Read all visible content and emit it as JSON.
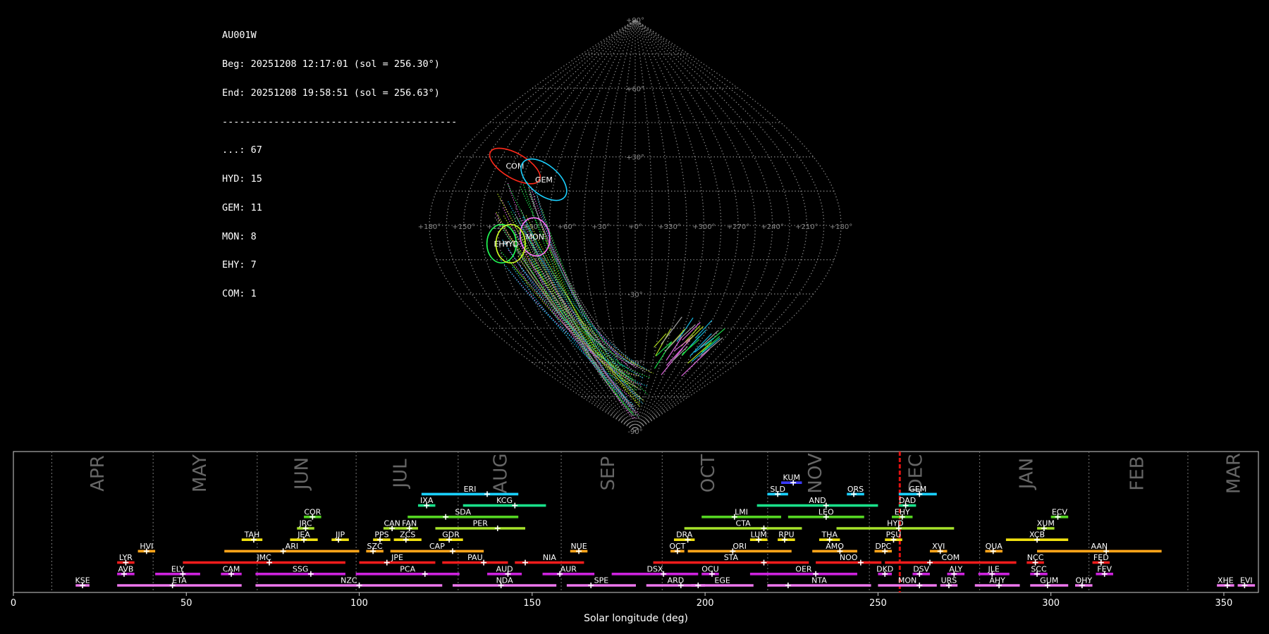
{
  "stats": {
    "station": "AU001W",
    "beg": "Beg: 20251208 12:17:01 (sol = 256.30°)",
    "end": "End: 20251208 19:58:51 (sol = 256.63°)",
    "sep": "-----------------------------------------",
    "counts": [
      "...: 67",
      "HYD: 15",
      "GEM: 11",
      "MON: 8",
      "EHY: 7",
      "COM: 1"
    ]
  },
  "sky_map": {
    "lat_labels": [
      {
        "text": "+90°",
        "lat": 90
      },
      {
        "text": "+60°",
        "lat": 60
      },
      {
        "text": "+30°",
        "lat": 30
      },
      {
        "text": "-30°",
        "lat": -30
      },
      {
        "text": "-60°",
        "lat": -60
      },
      {
        "text": "-90°",
        "lat": -90
      }
    ],
    "lon_labels": [
      {
        "text": "+180°",
        "lon": -180
      },
      {
        "text": "+150°",
        "lon": -150
      },
      {
        "text": "+120°",
        "lon": -120
      },
      {
        "text": "+90°",
        "lon": -90
      },
      {
        "text": "+60°",
        "lon": -60
      },
      {
        "text": "+30°",
        "lon": -30
      },
      {
        "text": "+0°",
        "lon": 0
      },
      {
        "text": "+330°",
        "lon": 30
      },
      {
        "text": "+300°",
        "lon": 60
      },
      {
        "text": "+270°",
        "lon": 90
      },
      {
        "text": "+240°",
        "lon": 120
      },
      {
        "text": "+210°",
        "lon": 150
      },
      {
        "text": "+180°",
        "lon": 180
      }
    ],
    "radiants": [
      {
        "name": "COM",
        "lon": -117,
        "lat": 26,
        "rx": 5.5,
        "ry": 12.5,
        "rot": -60,
        "color": "#ff2a1a"
      },
      {
        "name": "GEM",
        "lon": -85,
        "lat": 20,
        "rx": 6.5,
        "ry": 12,
        "rot": -50,
        "color": "#1ad0ff"
      },
      {
        "name": "MON",
        "lon": -88,
        "lat": -5,
        "rx": 6.5,
        "ry": 8.5,
        "rot": -10,
        "color": "#ff77ff"
      },
      {
        "name": "EHY",
        "lon": -118,
        "lat": -8,
        "rx": 6.5,
        "ry": 8.5,
        "rot": 0,
        "color": "#22ff55"
      },
      {
        "name": "HYD",
        "lon": -110,
        "lat": -8,
        "rx": 6.5,
        "ry": 8.5,
        "rot": 0,
        "color": "#ccff22"
      }
    ]
  },
  "chart_data": {
    "type": "timeline",
    "xlabel": "Solar longitude (deg)",
    "xlim": [
      0,
      360
    ],
    "xticks": [
      0,
      50,
      100,
      150,
      200,
      250,
      300,
      350
    ],
    "current_sol": 256.3,
    "months": [
      {
        "name": "APR",
        "start": 11.1,
        "label_at": 24.5
      },
      {
        "name": "MAY",
        "start": 40.4,
        "label_at": 54
      },
      {
        "name": "JUN",
        "start": 70.5,
        "label_at": 83.5
      },
      {
        "name": "JUL",
        "start": 99.1,
        "label_at": 112
      },
      {
        "name": "AUG",
        "start": 128.6,
        "label_at": 141
      },
      {
        "name": "SEP",
        "start": 158.4,
        "label_at": 172
      },
      {
        "name": "OCT",
        "start": 187.6,
        "label_at": 201
      },
      {
        "name": "NOV",
        "start": 218.1,
        "label_at": 232
      },
      {
        "name": "DEC",
        "start": 247.5,
        "label_at": 261
      },
      {
        "name": "JAN",
        "start": 279.4,
        "label_at": 293
      },
      {
        "name": "FEB",
        "start": 311.0,
        "label_at": 325
      },
      {
        "name": "MAR",
        "start": 339.6,
        "label_at": 353
      }
    ],
    "showers": [
      {
        "code": "KUM",
        "start": 222,
        "end": 228,
        "peak": 225.5,
        "row": 9,
        "color": "#3a3aff"
      },
      {
        "code": "ERI",
        "start": 118,
        "end": 146,
        "peak": 137,
        "row": 8,
        "color": "#1ad0ff"
      },
      {
        "code": "SLD",
        "start": 218,
        "end": 224,
        "peak": 221,
        "row": 8,
        "color": "#1ad0ff"
      },
      {
        "code": "ORS",
        "start": 241,
        "end": 246,
        "peak": 243,
        "row": 8,
        "color": "#1ad0ff"
      },
      {
        "code": "GEM",
        "start": 256,
        "end": 267,
        "peak": 262,
        "row": 8,
        "color": "#1ad0ff"
      },
      {
        "code": "IXA",
        "start": 117,
        "end": 122,
        "peak": 119.5,
        "row": 7,
        "color": "#19e08a"
      },
      {
        "code": "KCG",
        "start": 130,
        "end": 154,
        "peak": 145,
        "row": 7,
        "color": "#19e08a"
      },
      {
        "code": "AND",
        "start": 215,
        "end": 250,
        "peak": 235,
        "row": 7,
        "color": "#19e08a"
      },
      {
        "code": "DAD",
        "start": 256,
        "end": 261,
        "peak": 258,
        "row": 7,
        "color": "#19e08a"
      },
      {
        "code": "COR",
        "start": 84,
        "end": 89,
        "peak": 86.5,
        "row": 6,
        "color": "#55d422"
      },
      {
        "code": "SDA",
        "start": 114,
        "end": 146,
        "peak": 125,
        "row": 6,
        "color": "#55d422"
      },
      {
        "code": "LMI",
        "start": 199,
        "end": 222,
        "peak": 208.5,
        "row": 6,
        "color": "#55d422"
      },
      {
        "code": "LEO",
        "start": 224,
        "end": 246,
        "peak": 235,
        "row": 6,
        "color": "#55d422"
      },
      {
        "code": "EHY",
        "start": 254,
        "end": 260,
        "peak": 257,
        "row": 6,
        "color": "#55d422"
      },
      {
        "code": "ECV",
        "start": 300,
        "end": 305,
        "peak": 302,
        "row": 6,
        "color": "#55d422"
      },
      {
        "code": "JRC",
        "start": 82,
        "end": 87,
        "peak": 84.5,
        "row": 5,
        "color": "#a6e22a"
      },
      {
        "code": "CAN",
        "start": 107,
        "end": 112,
        "peak": 109.5,
        "row": 5,
        "color": "#a6e22a"
      },
      {
        "code": "FAN",
        "start": 112,
        "end": 117,
        "peak": 114.5,
        "row": 5,
        "color": "#a6e22a"
      },
      {
        "code": "PER",
        "start": 122,
        "end": 148,
        "peak": 140,
        "row": 5,
        "color": "#a6e22a"
      },
      {
        "code": "CTA",
        "start": 194,
        "end": 228,
        "peak": 217,
        "row": 5,
        "color": "#a6e22a"
      },
      {
        "code": "HYD",
        "start": 238,
        "end": 272,
        "peak": 256,
        "row": 5,
        "color": "#a6e22a"
      },
      {
        "code": "XUM",
        "start": 296,
        "end": 301,
        "peak": 298,
        "row": 5,
        "color": "#a6e22a"
      },
      {
        "code": "TAH",
        "start": 66,
        "end": 72,
        "peak": 69.5,
        "row": 4,
        "color": "#f0e010"
      },
      {
        "code": "JEA",
        "start": 80,
        "end": 88,
        "peak": 84,
        "row": 4,
        "color": "#f0e010"
      },
      {
        "code": "JIP",
        "start": 92,
        "end": 97,
        "peak": 94,
        "row": 4,
        "color": "#f0e010"
      },
      {
        "code": "PPS",
        "start": 104,
        "end": 109,
        "peak": 106,
        "row": 4,
        "color": "#f0e010"
      },
      {
        "code": "ZCS",
        "start": 110,
        "end": 118,
        "peak": 113.5,
        "row": 4,
        "color": "#f0e010"
      },
      {
        "code": "GDR",
        "start": 123,
        "end": 130,
        "peak": 126,
        "row": 4,
        "color": "#f0e010"
      },
      {
        "code": "DRA",
        "start": 191,
        "end": 197,
        "peak": 195,
        "row": 4,
        "color": "#f0e010"
      },
      {
        "code": "LUM",
        "start": 213,
        "end": 218,
        "peak": 215.5,
        "row": 4,
        "color": "#f0e010"
      },
      {
        "code": "RPU",
        "start": 221,
        "end": 226,
        "peak": 223,
        "row": 4,
        "color": "#f0e010"
      },
      {
        "code": "THA",
        "start": 233,
        "end": 239,
        "peak": 236,
        "row": 4,
        "color": "#f0e010"
      },
      {
        "code": "PSU",
        "start": 252,
        "end": 257,
        "peak": 254.5,
        "row": 4,
        "color": "#f0e010"
      },
      {
        "code": "XCB",
        "start": 287,
        "end": 305,
        "peak": 296,
        "row": 4,
        "color": "#f0e010"
      },
      {
        "code": "HVI",
        "start": 36,
        "end": 41,
        "peak": 38.5,
        "row": 3,
        "color": "#ffa51a"
      },
      {
        "code": "ARI",
        "start": 61,
        "end": 100,
        "peak": 78,
        "row": 3,
        "color": "#ffa51a"
      },
      {
        "code": "SZC",
        "start": 102,
        "end": 107,
        "peak": 104,
        "row": 3,
        "color": "#ffa51a"
      },
      {
        "code": "CAP",
        "start": 109,
        "end": 136,
        "peak": 127,
        "row": 3,
        "color": "#ffa51a"
      },
      {
        "code": "NUE",
        "start": 161,
        "end": 166,
        "peak": 163.5,
        "row": 3,
        "color": "#ffa51a"
      },
      {
        "code": "OCT",
        "start": 190,
        "end": 194,
        "peak": 192,
        "row": 3,
        "color": "#ffa51a"
      },
      {
        "code": "ORI",
        "start": 195,
        "end": 225,
        "peak": 208,
        "row": 3,
        "color": "#ffa51a"
      },
      {
        "code": "AMO",
        "start": 231,
        "end": 244,
        "peak": 239,
        "row": 3,
        "color": "#ffa51a"
      },
      {
        "code": "DPC",
        "start": 249,
        "end": 254,
        "peak": 252,
        "row": 3,
        "color": "#ffa51a"
      },
      {
        "code": "XVI",
        "start": 265,
        "end": 270,
        "peak": 268,
        "row": 3,
        "color": "#ffa51a"
      },
      {
        "code": "QUA",
        "start": 281,
        "end": 286,
        "peak": 283.3,
        "row": 3,
        "color": "#ffa51a"
      },
      {
        "code": "AAN",
        "start": 296,
        "end": 332,
        "peak": 316,
        "row": 3,
        "color": "#ffa51a"
      },
      {
        "code": "LYR",
        "start": 30,
        "end": 35,
        "peak": 32.5,
        "row": 2,
        "color": "#ee1c1c"
      },
      {
        "code": "JMC",
        "start": 49,
        "end": 96,
        "peak": 74,
        "row": 2,
        "color": "#ee1c1c"
      },
      {
        "code": "JPE",
        "start": 100,
        "end": 122,
        "peak": 108,
        "row": 2,
        "color": "#ee1c1c"
      },
      {
        "code": "PAU",
        "start": 124,
        "end": 143,
        "peak": 136,
        "row": 2,
        "color": "#ee1c1c"
      },
      {
        "code": "NIA",
        "start": 145,
        "end": 165,
        "peak": 148,
        "row": 2,
        "color": "#ee1c1c"
      },
      {
        "code": "STA",
        "start": 185,
        "end": 230,
        "peak": 217,
        "row": 2,
        "color": "#ee1c1c"
      },
      {
        "code": "NOO",
        "start": 232,
        "end": 251,
        "peak": 245,
        "row": 2,
        "color": "#ee1c1c"
      },
      {
        "code": "COM",
        "start": 252,
        "end": 290,
        "peak": 265,
        "row": 2,
        "color": "#ee1c1c"
      },
      {
        "code": "NCC",
        "start": 293,
        "end": 298,
        "peak": 295.5,
        "row": 2,
        "color": "#ee1c1c"
      },
      {
        "code": "FED",
        "start": 312,
        "end": 317,
        "peak": 314.5,
        "row": 2,
        "color": "#ee1c1c"
      },
      {
        "code": "AVB",
        "start": 30,
        "end": 35,
        "peak": 32,
        "row": 1,
        "color": "#cc22dd"
      },
      {
        "code": "ELY",
        "start": 41,
        "end": 54,
        "peak": 49,
        "row": 1,
        "color": "#cc22dd"
      },
      {
        "code": "CAM",
        "start": 60,
        "end": 66,
        "peak": 63,
        "row": 1,
        "color": "#cc22dd"
      },
      {
        "code": "SSG",
        "start": 70,
        "end": 96,
        "peak": 86,
        "row": 1,
        "color": "#cc22dd"
      },
      {
        "code": "PCA",
        "start": 99,
        "end": 129,
        "peak": 119,
        "row": 1,
        "color": "#cc22dd"
      },
      {
        "code": "AUD",
        "start": 137,
        "end": 147,
        "peak": 143,
        "row": 1,
        "color": "#cc22dd"
      },
      {
        "code": "AUR",
        "start": 153,
        "end": 168,
        "peak": 158,
        "row": 1,
        "color": "#cc22dd"
      },
      {
        "code": "DSX",
        "start": 173,
        "end": 198,
        "peak": 188,
        "row": 1,
        "color": "#cc22dd"
      },
      {
        "code": "OCU",
        "start": 199,
        "end": 204,
        "peak": 202,
        "row": 1,
        "color": "#cc22dd"
      },
      {
        "code": "OER",
        "start": 213,
        "end": 244,
        "peak": 232,
        "row": 1,
        "color": "#cc22dd"
      },
      {
        "code": "DKD",
        "start": 250,
        "end": 254,
        "peak": 252,
        "row": 1,
        "color": "#cc22dd"
      },
      {
        "code": "DSV",
        "start": 260,
        "end": 265,
        "peak": 262,
        "row": 1,
        "color": "#cc22dd"
      },
      {
        "code": "ALY",
        "start": 270,
        "end": 275,
        "peak": 272,
        "row": 1,
        "color": "#cc22dd"
      },
      {
        "code": "JLE",
        "start": 279,
        "end": 288,
        "peak": 283,
        "row": 1,
        "color": "#cc22dd"
      },
      {
        "code": "SCC",
        "start": 294,
        "end": 299,
        "peak": 296,
        "row": 1,
        "color": "#cc22dd"
      },
      {
        "code": "FEV",
        "start": 313,
        "end": 318,
        "peak": 315.5,
        "row": 1,
        "color": "#cc22dd"
      },
      {
        "code": "KSE",
        "start": 18,
        "end": 22,
        "peak": 20,
        "row": 0,
        "color": "#ee77ee"
      },
      {
        "code": "ETA",
        "start": 30,
        "end": 66,
        "peak": 46,
        "row": 0,
        "color": "#ee77ee"
      },
      {
        "code": "NZC",
        "start": 70,
        "end": 124,
        "peak": 100,
        "row": 0,
        "color": "#ee77ee"
      },
      {
        "code": "NDA",
        "start": 127,
        "end": 157,
        "peak": 141,
        "row": 0,
        "color": "#ee77ee"
      },
      {
        "code": "SPE",
        "start": 160,
        "end": 180,
        "peak": 167,
        "row": 0,
        "color": "#ee77ee"
      },
      {
        "code": "ARD",
        "start": 183,
        "end": 200,
        "peak": 193,
        "row": 0,
        "color": "#ee77ee"
      },
      {
        "code": "EGE",
        "start": 196,
        "end": 214,
        "peak": 198,
        "row": 0,
        "color": "#ee77ee"
      },
      {
        "code": "NTA",
        "start": 218,
        "end": 248,
        "peak": 224,
        "row": 0,
        "color": "#ee77ee"
      },
      {
        "code": "MON",
        "start": 250,
        "end": 267,
        "peak": 262,
        "row": 0,
        "color": "#ee77ee"
      },
      {
        "code": "URS",
        "start": 268,
        "end": 273,
        "peak": 270.5,
        "row": 0,
        "color": "#ee77ee"
      },
      {
        "code": "AHY",
        "start": 278,
        "end": 291,
        "peak": 285,
        "row": 0,
        "color": "#ee77ee"
      },
      {
        "code": "GUM",
        "start": 294,
        "end": 305,
        "peak": 299,
        "row": 0,
        "color": "#ee77ee"
      },
      {
        "code": "OHY",
        "start": 307,
        "end": 312,
        "peak": 309,
        "row": 0,
        "color": "#ee77ee"
      },
      {
        "code": "XHE",
        "start": 348,
        "end": 353,
        "peak": 351,
        "row": 0,
        "color": "#ee77ee"
      },
      {
        "code": "EVI",
        "start": 354,
        "end": 359,
        "peak": 356,
        "row": 0,
        "color": "#ee77ee"
      }
    ]
  }
}
